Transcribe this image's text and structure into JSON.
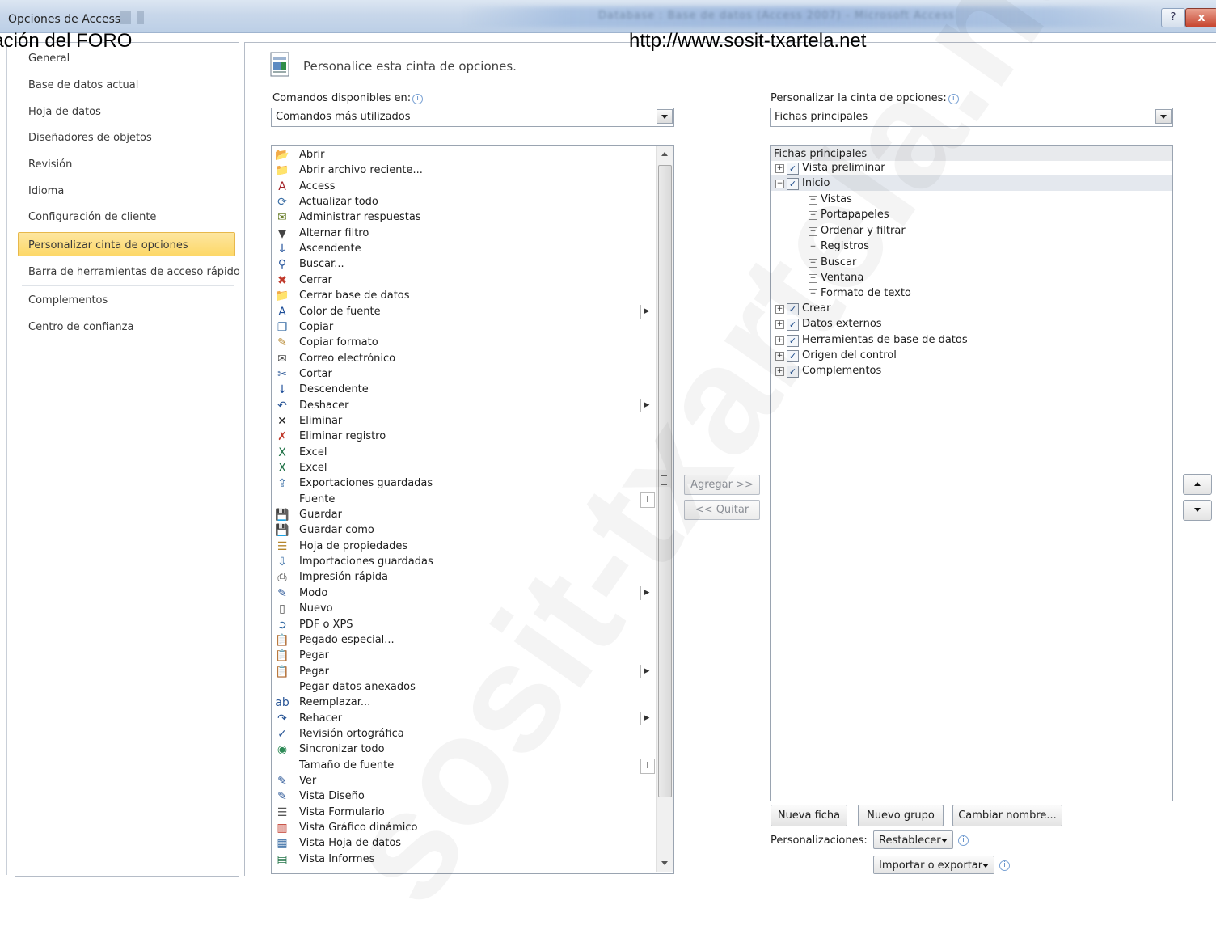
{
  "window": {
    "title": "Opciones de Access",
    "blurred_title": "Database : Base de datos (Access 2007) - Microsoft Access",
    "help_label": "?",
    "close_label": "x"
  },
  "overlay": {
    "left_text": "lación del FORO",
    "url_text": "http://www.sosit-txartela.net",
    "watermark": "sosit-txartela.net"
  },
  "sidebar": {
    "items": [
      {
        "label": "General"
      },
      {
        "label": "Base de datos actual"
      },
      {
        "label": "Hoja de datos"
      },
      {
        "label": "Diseñadores de objetos"
      },
      {
        "label": "Revisión"
      },
      {
        "label": "Idioma"
      },
      {
        "label": "Configuración de cliente"
      },
      {
        "label": "Personalizar cinta de opciones"
      },
      {
        "label": "Barra de herramientas de acceso rápido"
      },
      {
        "label": "Complementos"
      },
      {
        "label": "Centro de confianza"
      }
    ],
    "selected": "Personalizar cinta de opciones"
  },
  "main": {
    "header": "Personalice esta cinta de opciones.",
    "commands_label": "Comandos disponibles en:",
    "commands_combo": "Comandos más utilizados",
    "ribbon_label": "Personalizar la cinta de opciones:",
    "ribbon_combo": "Fichas principales",
    "info_glyph": "i"
  },
  "commands": [
    {
      "label": "Abrir",
      "icon": "open-folder-icon",
      "glyph": "📂",
      "color": "#c99a2e"
    },
    {
      "label": "Abrir archivo reciente...",
      "icon": "recent-file-icon",
      "glyph": "📁",
      "color": "#c99a2e"
    },
    {
      "label": "Access",
      "icon": "access-icon",
      "glyph": "A",
      "color": "#a4262c"
    },
    {
      "label": "Actualizar todo",
      "icon": "refresh-all-icon",
      "glyph": "⟳",
      "color": "#3a6ea5"
    },
    {
      "label": "Administrar respuestas",
      "icon": "manage-replies-icon",
      "glyph": "✉",
      "color": "#6a7f2c"
    },
    {
      "label": "Alternar filtro",
      "icon": "toggle-filter-icon",
      "glyph": "▼",
      "color": "#444"
    },
    {
      "label": "Ascendente",
      "icon": "sort-ascending-icon",
      "glyph": "↓",
      "color": "#1f4f99"
    },
    {
      "label": "Buscar...",
      "icon": "binoculars-icon",
      "glyph": "⚲",
      "color": "#1f4f99"
    },
    {
      "label": "Cerrar",
      "icon": "close-db-icon",
      "glyph": "✖",
      "color": "#c0392b"
    },
    {
      "label": "Cerrar base de datos",
      "icon": "close-database-icon",
      "glyph": "📁",
      "color": "#c99a2e"
    },
    {
      "label": "Color de fuente",
      "icon": "font-color-icon",
      "glyph": "A",
      "color": "#1f4f99",
      "submenu": "arrow"
    },
    {
      "label": "Copiar",
      "icon": "copy-icon",
      "glyph": "❐",
      "color": "#3a6ea5"
    },
    {
      "label": "Copiar formato",
      "icon": "format-painter-icon",
      "glyph": "✎",
      "color": "#b5852b"
    },
    {
      "label": "Correo electrónico",
      "icon": "email-icon",
      "glyph": "✉",
      "color": "#555"
    },
    {
      "label": "Cortar",
      "icon": "scissors-icon",
      "glyph": "✂",
      "color": "#2b5797"
    },
    {
      "label": "Descendente",
      "icon": "sort-descending-icon",
      "glyph": "↓",
      "color": "#1f4f99"
    },
    {
      "label": "Deshacer",
      "icon": "undo-icon",
      "glyph": "↶",
      "color": "#2b5797",
      "submenu": "arrow"
    },
    {
      "label": "Eliminar",
      "icon": "delete-icon",
      "glyph": "✕",
      "color": "#222"
    },
    {
      "label": "Eliminar registro",
      "icon": "delete-record-icon",
      "glyph": "✗",
      "color": "#c0392b"
    },
    {
      "label": "Excel",
      "icon": "excel-import-icon",
      "glyph": "X",
      "color": "#1e7145"
    },
    {
      "label": "Excel",
      "icon": "excel-export-icon",
      "glyph": "X",
      "color": "#1e7145"
    },
    {
      "label": "Exportaciones guardadas",
      "icon": "saved-exports-icon",
      "glyph": "⇪",
      "color": "#3a6ea5"
    },
    {
      "label": "Fuente",
      "icon": "font-icon",
      "glyph": "",
      "color": "#222",
      "submenu": "box"
    },
    {
      "label": "Guardar",
      "icon": "save-icon",
      "glyph": "💾",
      "color": "#2b5797"
    },
    {
      "label": "Guardar como",
      "icon": "save-as-icon",
      "glyph": "💾",
      "color": "#2b5797"
    },
    {
      "label": "Hoja de propiedades",
      "icon": "property-sheet-icon",
      "glyph": "☰",
      "color": "#b5852b"
    },
    {
      "label": "Importaciones guardadas",
      "icon": "saved-imports-icon",
      "glyph": "⇩",
      "color": "#3a6ea5"
    },
    {
      "label": "Impresión rápida",
      "icon": "quick-print-icon",
      "glyph": "⎙",
      "color": "#444"
    },
    {
      "label": "Modo",
      "icon": "view-mode-icon",
      "glyph": "✎",
      "color": "#2b5797",
      "submenu": "arrow"
    },
    {
      "label": "Nuevo",
      "icon": "new-document-icon",
      "glyph": "▯",
      "color": "#555"
    },
    {
      "label": "PDF o XPS",
      "icon": "pdf-xps-icon",
      "glyph": "➲",
      "color": "#3a6ea5"
    },
    {
      "label": "Pegado especial...",
      "icon": "paste-special-icon",
      "glyph": "📋",
      "color": "#b5852b"
    },
    {
      "label": "Pegar",
      "icon": "paste-icon",
      "glyph": "📋",
      "color": "#b5852b"
    },
    {
      "label": "Pegar",
      "icon": "paste-dropdown-icon",
      "glyph": "📋",
      "color": "#b5852b",
      "submenu": "arrow"
    },
    {
      "label": "Pegar datos anexados",
      "icon": "paste-append-icon",
      "glyph": "",
      "color": "#555"
    },
    {
      "label": "Reemplazar...",
      "icon": "replace-icon",
      "glyph": "ab",
      "color": "#2b5797"
    },
    {
      "label": "Rehacer",
      "icon": "redo-icon",
      "glyph": "↷",
      "color": "#2b5797",
      "submenu": "arrow"
    },
    {
      "label": "Revisión ortográfica",
      "icon": "spelling-icon",
      "glyph": "✓",
      "color": "#2b5797"
    },
    {
      "label": "Sincronizar todo",
      "icon": "sync-all-icon",
      "glyph": "◉",
      "color": "#2e8b57"
    },
    {
      "label": "Tamaño de fuente",
      "icon": "font-size-icon",
      "glyph": "",
      "color": "#222",
      "submenu": "box"
    },
    {
      "label": "Ver",
      "icon": "view-icon",
      "glyph": "✎",
      "color": "#2b5797"
    },
    {
      "label": "Vista Diseño",
      "icon": "design-view-icon",
      "glyph": "✎",
      "color": "#2b5797"
    },
    {
      "label": "Vista Formulario",
      "icon": "form-view-icon",
      "glyph": "☰",
      "color": "#555"
    },
    {
      "label": "Vista Gráfico dinámico",
      "icon": "pivot-chart-icon",
      "glyph": "▥",
      "color": "#c0392b"
    },
    {
      "label": "Vista Hoja de datos",
      "icon": "datasheet-view-icon",
      "glyph": "▦",
      "color": "#3a6ea5"
    },
    {
      "label": "Vista Informes",
      "icon": "report-view-icon",
      "glyph": "▤",
      "color": "#1e7145"
    }
  ],
  "middle": {
    "add_label": "Agregar >>",
    "remove_label": "<< Quitar"
  },
  "tree": {
    "header": "Fichas principales",
    "nodes": [
      {
        "label": "Vista preliminar",
        "level": 0,
        "expand": "+",
        "checked": true
      },
      {
        "label": "Inicio",
        "level": 0,
        "expand": "−",
        "checked": true,
        "selected": true
      },
      {
        "label": "Vistas",
        "level": 1,
        "expand": "+"
      },
      {
        "label": "Portapapeles",
        "level": 1,
        "expand": "+"
      },
      {
        "label": "Ordenar y filtrar",
        "level": 1,
        "expand": "+"
      },
      {
        "label": "Registros",
        "level": 1,
        "expand": "+"
      },
      {
        "label": "Buscar",
        "level": 1,
        "expand": "+"
      },
      {
        "label": "Ventana",
        "level": 1,
        "expand": "+"
      },
      {
        "label": "Formato de texto",
        "level": 1,
        "expand": "+"
      },
      {
        "label": "Crear",
        "level": 0,
        "expand": "+",
        "checked": true
      },
      {
        "label": "Datos externos",
        "level": 0,
        "expand": "+",
        "checked": true
      },
      {
        "label": "Herramientas de base de datos",
        "level": 0,
        "expand": "+",
        "checked": true
      },
      {
        "label": "Origen del control",
        "level": 0,
        "expand": "+",
        "checked": true
      },
      {
        "label": "Complementos",
        "level": 0,
        "expand": "+",
        "checked": true
      }
    ]
  },
  "bottom": {
    "new_tab": "Nueva ficha",
    "new_group": "Nuevo grupo",
    "rename": "Cambiar nombre...",
    "customizations_label": "Personalizaciones:",
    "reset": "Restablecer",
    "import_export": "Importar o exportar"
  }
}
